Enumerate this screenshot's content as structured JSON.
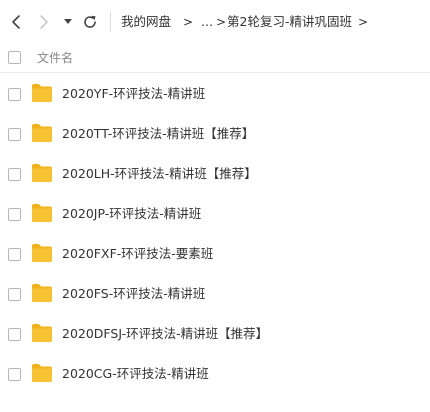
{
  "breadcrumb": {
    "root": "我的网盘",
    "sep1": ">",
    "ellipsis": "...",
    "sep2": ">",
    "current": "第2轮复习-精讲巩固班",
    "sep3": ">"
  },
  "icons": {
    "back": "chevron-left-icon",
    "forward": "chevron-right-icon",
    "dropdown": "caret-down-icon",
    "refresh": "refresh-icon",
    "folder": "folder-icon"
  },
  "colors": {
    "folder": "#F8C235",
    "folder_tab": "#F2B21C",
    "nav_disabled": "#c8c8c8"
  },
  "list": {
    "header_label": "文件名",
    "files": [
      {
        "name": "2020YF-环评技法-精讲班",
        "tag": ""
      },
      {
        "name": "2020TT-环评技法-精讲班",
        "tag": "【推荐】"
      },
      {
        "name": "2020LH-环评技法-精讲班",
        "tag": "【推荐】"
      },
      {
        "name": "2020JP-环评技法-精讲班",
        "tag": ""
      },
      {
        "name": "2020FXF-环评技法-要素班",
        "tag": ""
      },
      {
        "name": "2020FS-环评技法-精讲班",
        "tag": ""
      },
      {
        "name": "2020DFSJ-环评技法-精讲班",
        "tag": "【推荐】"
      },
      {
        "name": "2020CG-环评技法-精讲班",
        "tag": ""
      }
    ]
  }
}
